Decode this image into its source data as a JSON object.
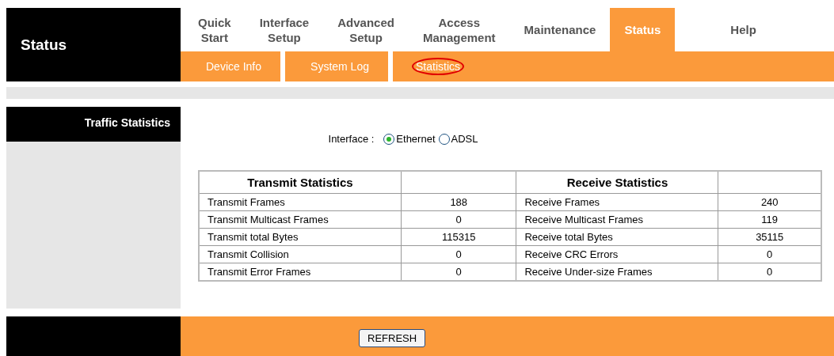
{
  "brand": {
    "title": "Status"
  },
  "main_tabs": [
    {
      "label": "Quick\nStart",
      "selected": false
    },
    {
      "label": "Interface\nSetup",
      "selected": false
    },
    {
      "label": "Advanced\nSetup",
      "selected": false
    },
    {
      "label": "Access\nManagement",
      "selected": false
    },
    {
      "label": "Maintenance",
      "selected": false
    },
    {
      "label": "Status",
      "selected": true
    },
    {
      "label": "Help",
      "selected": false
    }
  ],
  "sub_tabs": [
    {
      "label": "Device Info",
      "selected": false
    },
    {
      "label": "System Log",
      "selected": false
    },
    {
      "label": "Statistics",
      "selected": true
    }
  ],
  "section": {
    "title": "Traffic Statistics"
  },
  "interface": {
    "label": "Interface :",
    "options": [
      {
        "label": "Ethernet",
        "selected": true
      },
      {
        "label": "ADSL",
        "selected": false
      }
    ]
  },
  "table": {
    "columns": [
      "Transmit Statistics",
      "",
      "Receive Statistics",
      ""
    ],
    "rows": [
      [
        "Transmit Frames",
        "188",
        "Receive Frames",
        "240"
      ],
      [
        "Transmit Multicast Frames",
        "0",
        "Receive Multicast Frames",
        "119"
      ],
      [
        "Transmit total Bytes",
        "115315",
        "Receive total Bytes",
        "35115"
      ],
      [
        "Transmit Collision",
        "0",
        "Receive CRC Errors",
        "0"
      ],
      [
        "Transmit Error Frames",
        "0",
        "Receive Under-size Frames",
        "0"
      ]
    ]
  },
  "footer": {
    "button": "REFRESH"
  }
}
